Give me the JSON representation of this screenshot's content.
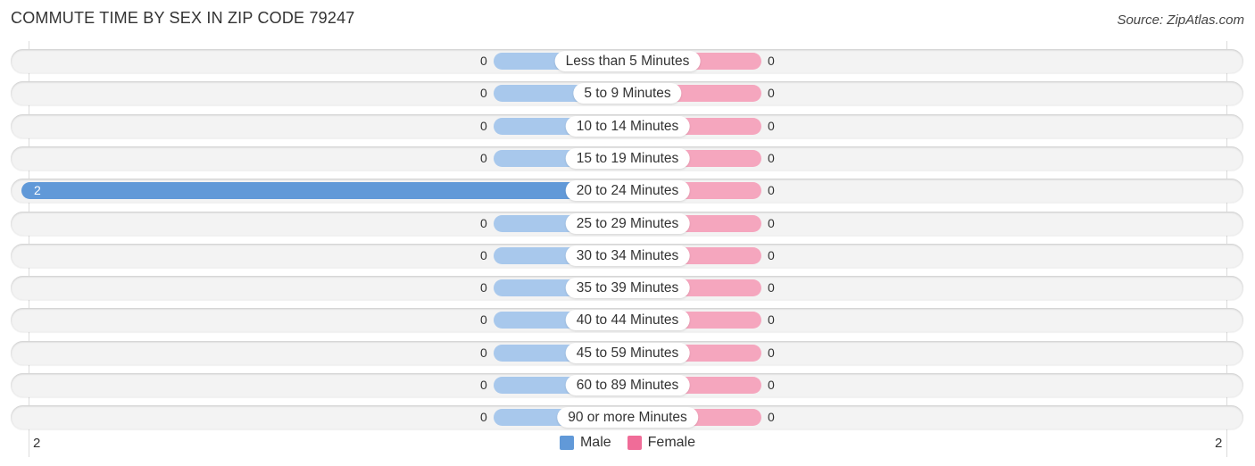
{
  "header": {
    "title": "COMMUTE TIME BY SEX IN ZIP CODE 79247",
    "source": "Source: ZipAtlas.com"
  },
  "colors": {
    "male": "#6199d8",
    "male_light": "#a8c8ec",
    "female": "#f06c98",
    "female_light": "#f5a6be"
  },
  "chart_data": {
    "type": "bar",
    "orientation": "horizontal-diverging",
    "title": "COMMUTE TIME BY SEX IN ZIP CODE 79247",
    "categories": [
      "Less than 5 Minutes",
      "5 to 9 Minutes",
      "10 to 14 Minutes",
      "15 to 19 Minutes",
      "20 to 24 Minutes",
      "25 to 29 Minutes",
      "30 to 34 Minutes",
      "35 to 39 Minutes",
      "40 to 44 Minutes",
      "45 to 59 Minutes",
      "60 to 89 Minutes",
      "90 or more Minutes"
    ],
    "series": [
      {
        "name": "Male",
        "values": [
          0,
          0,
          0,
          0,
          2,
          0,
          0,
          0,
          0,
          0,
          0,
          0
        ]
      },
      {
        "name": "Female",
        "values": [
          0,
          0,
          0,
          0,
          0,
          0,
          0,
          0,
          0,
          0,
          0,
          0
        ]
      }
    ],
    "axis": {
      "left_max_label": "2",
      "right_max_label": "2",
      "xlim": [
        -2,
        2
      ]
    },
    "legend": {
      "placement": "bottom-center",
      "entries": [
        "Male",
        "Female"
      ]
    },
    "grid": true
  }
}
